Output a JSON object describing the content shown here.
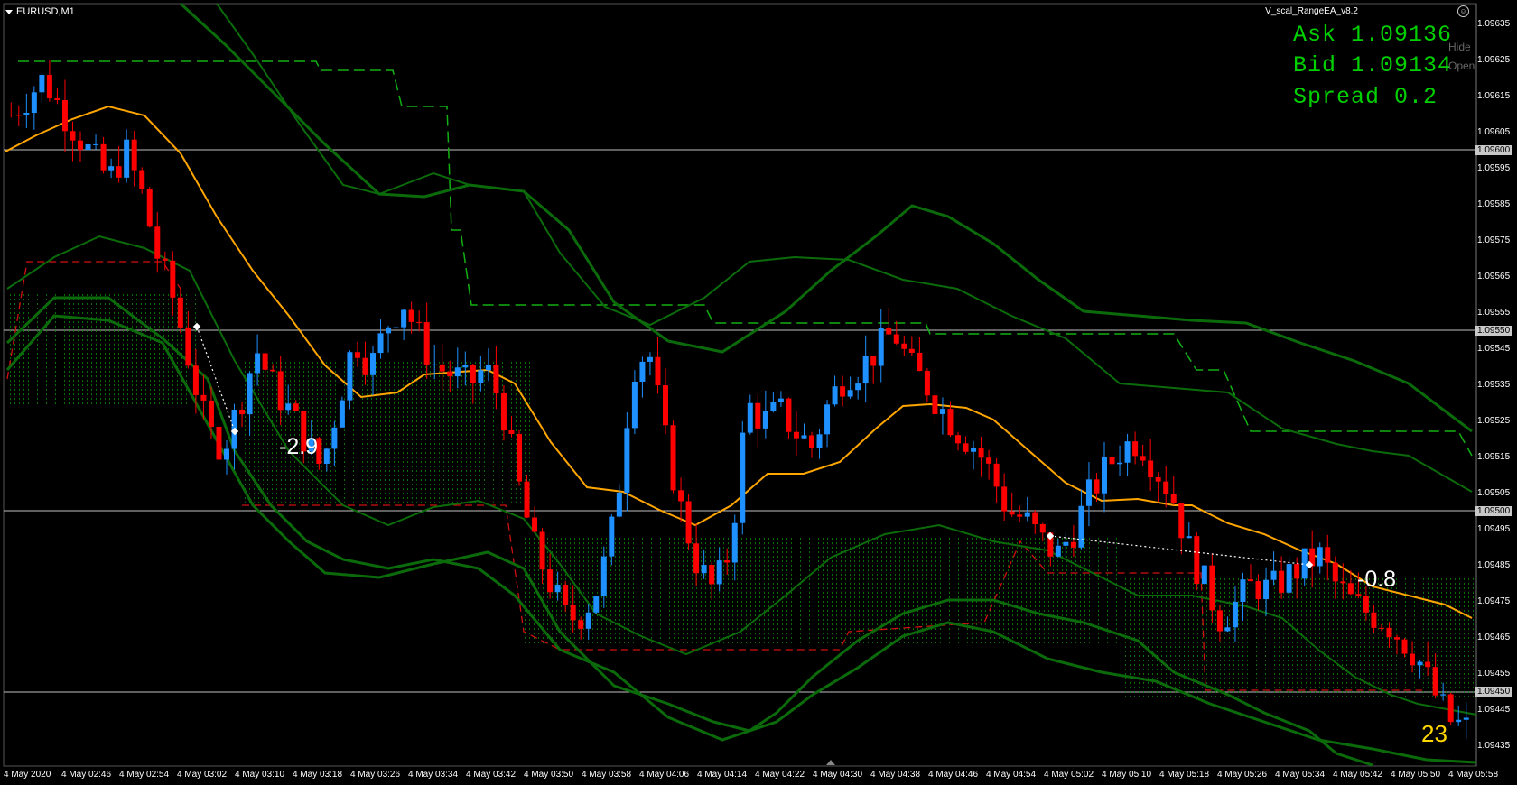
{
  "window": {
    "symbol": "EURUSD,M1",
    "expert_name": "V_scal_RangeEA_v8.2"
  },
  "quote_panel": {
    "ask": "Ask 1.09136",
    "bid": "Bid 1.09134",
    "spread": "Spread 0.2",
    "hide_label": "Hide",
    "open_label": "Open"
  },
  "annotations": {
    "left_value": "-2.9",
    "right_value": "-0.8",
    "counter": "23"
  },
  "colors": {
    "background": "#000000",
    "bull_candle": "#1e90ff",
    "bear_candle": "#ff0000",
    "envelope": "#006400",
    "moving_average": "#ffa500",
    "range_box": "#00aa00",
    "quote_text": "#00d000"
  },
  "chart_data": {
    "type": "candlestick",
    "symbol": "EURUSD",
    "timeframe": "M1",
    "ylim": [
      1.0943,
      1.0964
    ],
    "y_ticks": [
      "1.09635",
      "1.09625",
      "1.09615",
      "1.09605",
      "1.09595",
      "1.09585",
      "1.09575",
      "1.09565",
      "1.09555",
      "1.09545",
      "1.09535",
      "1.09525",
      "1.09515",
      "1.09505",
      "1.09495",
      "1.09485",
      "1.09475",
      "1.09465",
      "1.09455",
      "1.09445",
      "1.09435"
    ],
    "highlighted_levels": [
      "1.09600",
      "1.09550",
      "1.09500",
      "1.09450"
    ],
    "x_ticks": [
      "4 May 2020",
      "4 May 02:46",
      "4 May 02:54",
      "4 May 03:02",
      "4 May 03:10",
      "4 May 03:18",
      "4 May 03:26",
      "4 May 03:34",
      "4 May 03:42",
      "4 May 03:50",
      "4 May 03:58",
      "4 May 04:06",
      "4 May 04:14",
      "4 May 04:22",
      "4 May 04:30",
      "4 May 04:38",
      "4 May 04:46",
      "4 May 04:54",
      "4 May 05:02",
      "4 May 05:10",
      "4 May 05:18",
      "4 May 05:26",
      "4 May 05:34",
      "4 May 05:42",
      "4 May 05:50",
      "4 May 05:58"
    ],
    "close_path": [
      1.0961,
      1.09615,
      1.0962,
      1.09612,
      1.09605,
      1.09598,
      1.09592,
      1.096,
      1.09588,
      1.0957,
      1.09558,
      1.0954,
      1.09522,
      1.09518,
      1.0953,
      1.09545,
      1.09535,
      1.09528,
      1.0952,
      1.09512,
      1.0953,
      1.09548,
      1.0954,
      1.09552,
      1.09558,
      1.09548,
      1.0954,
      1.09538,
      1.09535,
      1.0954,
      1.0953,
      1.09508,
      1.0949,
      1.0948,
      1.0947,
      1.09472,
      1.0948,
      1.095,
      1.0954,
      1.09545,
      1.0952,
      1.095,
      1.09485,
      1.09478,
      1.0949,
      1.0953,
      1.09525,
      1.09528,
      1.09522,
      1.09518,
      1.0953,
      1.09538,
      1.0954,
      1.09545,
      1.0955,
      1.0954,
      1.09535,
      1.09528,
      1.09522,
      1.09518,
      1.0951,
      1.095,
      1.09498,
      1.09492,
      1.09488,
      1.09495,
      1.09505,
      1.09512,
      1.09518,
      1.0952,
      1.09512,
      1.09505,
      1.0949,
      1.0948,
      1.0947,
      1.09475,
      1.0948,
      1.09478,
      1.09482,
      1.09485,
      1.09488,
      1.0948,
      1.09475,
      1.09472,
      1.0947,
      1.09465,
      1.0946,
      1.0945,
      1.09442,
      1.0944
    ]
  }
}
